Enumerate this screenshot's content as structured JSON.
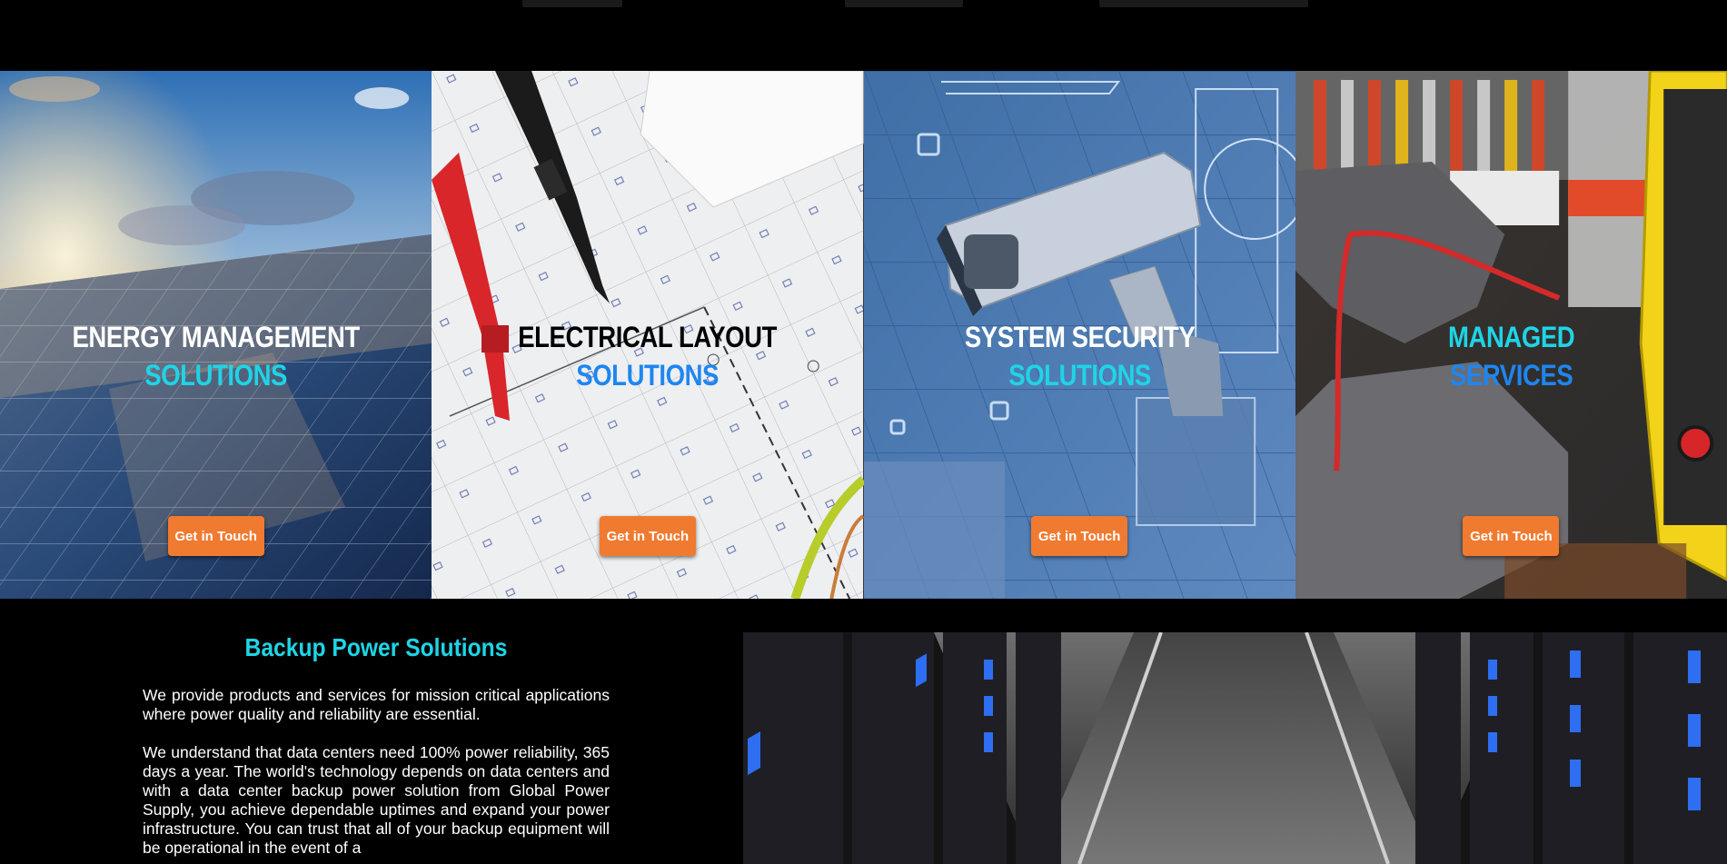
{
  "panels": [
    {
      "line1": "ENERGY MANAGEMENT",
      "line2": "SOLUTIONS",
      "button": "Get in Touch",
      "color1": "#ffffff",
      "color2": "#1fd4e6"
    },
    {
      "line1": "ELECTRICAL LAYOUT",
      "line2": "SOLUTIONS",
      "button": "Get in Touch",
      "color1": "#000000",
      "color2": "#1e86f0"
    },
    {
      "line1": "SYSTEM SECURITY",
      "line2": "SOLUTIONS",
      "button": "Get in Touch",
      "color1": "#ffffff",
      "color2": "#1fd4e6"
    },
    {
      "line1": "MANAGED",
      "line2": "SERVICES",
      "button": "Get in Touch",
      "color1": "#1fd4e6",
      "color2": "#1e86f0"
    }
  ],
  "backup": {
    "heading": "Backup Power Solutions",
    "para1": "We provide products and services for mission critical applications where power quality and reliability are essential.",
    "para2": "We understand that data centers need 100% power reliability, 365 days a year. The world's technology depends on data centers and with a data center backup power solution from Global Power Supply, you achieve dependable uptimes and expand your power infrastructure. You can trust that all of your backup equipment will be operational in the event of a"
  },
  "colors": {
    "accent_cyan": "#1fd4e6",
    "accent_blue": "#1e86f0",
    "button_orange": "#f07a30",
    "background": "#000000"
  }
}
